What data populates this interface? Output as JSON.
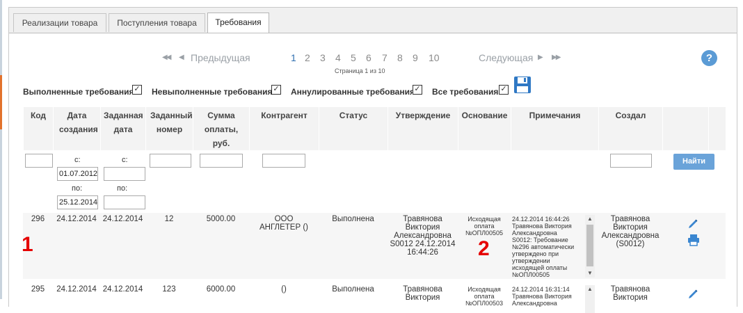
{
  "tabs": [
    {
      "label": "Реализации товара",
      "active": false
    },
    {
      "label": "Поступления товара",
      "active": false
    },
    {
      "label": "Требования",
      "active": true
    }
  ],
  "pager": {
    "prev": "Предыдущая",
    "next": "Следующая",
    "first_arrows": "◀◀",
    "prev_arrow": "◀",
    "next_arrow": "▶",
    "last_arrows": "▶▶",
    "pages": [
      "1",
      "2",
      "3",
      "4",
      "5",
      "6",
      "7",
      "8",
      "9",
      "10"
    ],
    "current": "1",
    "info": "Страница 1 из 10"
  },
  "help": {
    "label": "?",
    "icon": "help-circle-icon"
  },
  "filters": [
    {
      "label": "Выполненные требования",
      "checked": true
    },
    {
      "label": "Невыполненные требования",
      "checked": true
    },
    {
      "label": "Аннулированные требования",
      "checked": true
    },
    {
      "label": "Все требования",
      "checked": true
    }
  ],
  "checkmark": "✓",
  "columns": {
    "kod": "Код",
    "date_created": "Дата создания",
    "date_set": "Заданная дата",
    "num_set": "Заданный номер",
    "sum": "Сумма оплаты, руб.",
    "contractor": "Контрагент",
    "status": "Статус",
    "approval": "Утверждение",
    "basis": "Основание",
    "notes": "Примечания",
    "creator": "Создал"
  },
  "filter_inputs": {
    "from_label": "с:",
    "to_label": "по:",
    "date_created_from": "01.07.2012",
    "date_created_to": "25.12.2014",
    "date_set_from": "",
    "date_set_to": "",
    "find_button": "Найти"
  },
  "rows": [
    {
      "kod": "296",
      "date_created": "24.12.2014",
      "date_set": "24.12.2014",
      "num_set": "12",
      "sum": "5000.00",
      "contractor": "ООО АНГЛЕТЕР ()",
      "status": "Выполнена",
      "approval": [
        "Травянова",
        "Виктория",
        "Александровна",
        "S0012 24.12.2014",
        "16:44:26"
      ],
      "basis": [
        "Исходящая",
        "оплата",
        "№ОПЛ00505"
      ],
      "notes": [
        "24.12.2014 16:44:26",
        "Травянова Виктория",
        "Александровна",
        "S0012: Требование",
        "№296 автоматически",
        "утверждено при",
        "утверждении",
        "исходящей оплаты",
        "№ОПЛ00505"
      ],
      "creator": [
        "Травянова",
        "Виктория",
        "Александровна",
        "(S0012)"
      ]
    },
    {
      "kod": "295",
      "date_created": "24.12.2014",
      "date_set": "24.12.2014",
      "num_set": "123",
      "sum": "6000.00",
      "contractor": "()",
      "status": "Выполнена",
      "approval": [
        "Травянова",
        "Виктория"
      ],
      "basis": [
        "Исходящая",
        "оплата",
        "№ОПЛ00503"
      ],
      "notes": [
        "24.12.2014 16:31:14",
        "Травянова Виктория",
        "Александровна"
      ],
      "creator": [
        "Травянова",
        "Виктория"
      ]
    }
  ],
  "annotations": [
    "1",
    "2"
  ],
  "icons": {
    "save": "save-disk-icon",
    "edit": "pencil-edit-icon",
    "print": "printer-icon"
  },
  "colors": {
    "accent": "#5b9bd5",
    "button": "#6aa3d9",
    "annotation": "#e50000",
    "current_page": "#2f6fb0"
  }
}
